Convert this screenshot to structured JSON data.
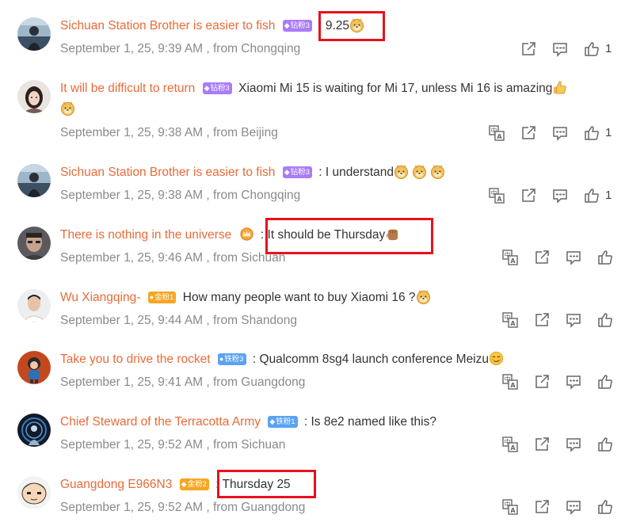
{
  "badges": {
    "diamond3": {
      "label": "钻粉3",
      "color": "#a97cf6"
    },
    "gold1": {
      "label": "金粉1",
      "color": "#f5a623"
    },
    "iron3": {
      "label": "铁粉3",
      "color": "#5aa2f3"
    },
    "iron1": {
      "label": "铁粉1",
      "color": "#5aa2f3"
    },
    "gold2": {
      "label": "金粉2",
      "color": "#f5a623"
    }
  },
  "comments": [
    {
      "username": "Sichuan Station Brother is easier to fish",
      "badge": "钻粉3",
      "text": ": 9.25",
      "emoji": "doge-emoji",
      "meta": "September 1, 25, 9:39 AM , from Chongqing",
      "like_count": "1"
    },
    {
      "username": "It will be difficult to return",
      "badge": "钻粉3",
      "text": "Xiaomi Mi 15 is waiting for Mi 17, unless Mi 16 is amazing",
      "emoji": "thumbs-up-emoji doge-emoji",
      "meta": "September 1, 25, 9:38 AM , from Beijing",
      "like_count": "1"
    },
    {
      "username": "Sichuan Station Brother is easier to fish",
      "badge": "钻粉3",
      "text": ": I understand",
      "emoji": "doge-emoji x3",
      "meta": "September 1, 25, 9:38 AM , from Chongqing",
      "like_count": "1"
    },
    {
      "username": "There is nothing in the universe",
      "badge": "",
      "text": ": It should be Thursday",
      "emoji": "fist-emoji",
      "meta": "September 1, 25, 9:46 AM , from Sichuan",
      "like_count": ""
    },
    {
      "username": "Wu Xiangqing-",
      "badge": "金粉1",
      "text": "How many people want to buy Xiaomi 16 ?",
      "emoji": "doge-emoji",
      "meta": "September 1, 25, 9:44 AM , from Shandong",
      "like_count": ""
    },
    {
      "username": "Take you to drive the rocket",
      "badge": "铁粉3",
      "text": ": Qualcomm 8sg4 launch conference Meizu",
      "emoji": "smirk-emoji",
      "meta": "September 1, 25, 9:41 AM , from Guangdong",
      "like_count": ""
    },
    {
      "username": "Chief Steward of the Terracotta Army",
      "badge": "铁粉1",
      "text": ": Is 8e2 named like this?",
      "emoji": "",
      "meta": "September 1, 25, 9:52 AM , from Sichuan",
      "like_count": ""
    },
    {
      "username": "Guangdong E966N3",
      "badge": "金粉2",
      "text": ": Thursday 25",
      "emoji": "",
      "meta": "September 1, 25, 9:52 AM , from Guangdong",
      "like_count": ""
    }
  ],
  "icons": {
    "translate": "translate-icon",
    "share": "share-icon",
    "comment": "comment-icon",
    "like": "like-icon"
  },
  "colors": {
    "username": "#e86b38",
    "meta": "#8a8a8a",
    "highlight": "#e8111b"
  }
}
